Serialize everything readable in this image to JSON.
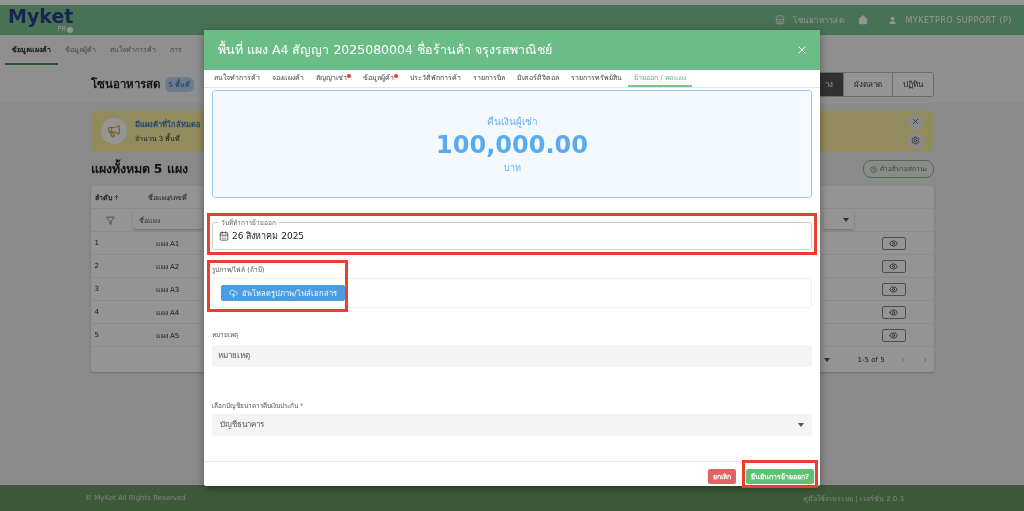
{
  "app_header": {
    "logo": "Myket",
    "logo_sub": "PR",
    "zone": "โซนอาหารสด",
    "user": "MYKETPRO SUPPORT (P)"
  },
  "nav_tabs": [
    {
      "label": "ข้อมูลแผงค้า",
      "selected": true
    },
    {
      "label": "ข้อมูลผู้ค้า",
      "selected": false
    },
    {
      "label": "สนใจทำการค้า",
      "selected": false
    },
    {
      "label": "การ",
      "selected": false
    }
  ],
  "page": {
    "title": "โซนอาหารสด",
    "badge": "5 พื้นที่",
    "view_buttons": [
      {
        "label": "าง",
        "selected": true
      },
      {
        "label": "ผังตลาด",
        "selected": false
      },
      {
        "label": "ปฏิทิน",
        "selected": false
      }
    ],
    "banner": {
      "title": "มีแผงค้าที่ใกล้หมดอ",
      "text": "จำนวน 3 พื้นที่"
    },
    "section_title": "แผงทั้งหมด 5 แผง",
    "legend_button": "คำอธิบายสถานะ"
  },
  "table": {
    "columns": [
      {
        "label": "ลำดับ",
        "sorted": true
      },
      {
        "label": "ชื่อแผง/เลขที่",
        "sorted": false
      }
    ],
    "filter_placeholder": "ชื่อแผง",
    "rows": [
      {
        "index": "1",
        "name": "แผง A1"
      },
      {
        "index": "2",
        "name": "แผง A2"
      },
      {
        "index": "3",
        "name": "แผง A3"
      },
      {
        "index": "4",
        "name": "แผง A4"
      },
      {
        "index": "5",
        "name": "แผง A5"
      }
    ],
    "pagination": "1-5 of 5"
  },
  "footer": {
    "copyright": "© MyKet All Rights Reserved",
    "links": "คู่มือใช้งานระบบ | เวอร์ชั่น 2.0.3"
  },
  "modal": {
    "title": "พื้นที่ แผง A4 สัญญา 2025080004 ชื่อร้านค้า จรุงรสพาณิชย์",
    "tabs": [
      {
        "label": "สนใจทำการค้า",
        "selected": false,
        "alert": false
      },
      {
        "label": "จองแผงค้า",
        "selected": false,
        "alert": false
      },
      {
        "label": "สัญญาเช่า",
        "selected": false,
        "alert": true
      },
      {
        "label": "ข้อมูลผู้ค้า",
        "selected": false,
        "alert": true
      },
      {
        "label": "ประวัติพักการค้า",
        "selected": false,
        "alert": false
      },
      {
        "label": "รายการบิล",
        "selected": false,
        "alert": false
      },
      {
        "label": "มิเตอร์ดิจิตอล",
        "selected": false,
        "alert": false
      },
      {
        "label": "รายการทรัพย์สิน",
        "selected": false,
        "alert": false
      },
      {
        "label": "ย้ายออก / ลดแผง",
        "selected": true,
        "alert": false
      }
    ],
    "refund": {
      "label": "คืนเงินผู้เช่า",
      "amount": "100,000.00",
      "unit": "บาท"
    },
    "move_out_date": {
      "label": "วันที่ทำการย้ายออก",
      "value": "26 สิงหาคม 2025",
      "highlighted": true
    },
    "attachment": {
      "label": "รูปภาพ/ไฟล์ (ถ้ามี)",
      "button": "อัพโหลดรูปภาพ/ไฟล์เอกสาร",
      "highlighted": true
    },
    "note": {
      "label": "หมายเหตุ",
      "placeholder": "หมายเหตุ"
    },
    "bank_account": {
      "label": "เลือกบัญชีธนาคารคืนเงินประกัน *",
      "placeholder": "บัญชีธนาคาร"
    },
    "buttons": [
      {
        "kind": "cancel",
        "label": "ยกเลิก",
        "highlighted": false
      },
      {
        "kind": "confirm",
        "label": "ยืนยันการย้ายออก?",
        "highlighted": true
      }
    ]
  }
}
